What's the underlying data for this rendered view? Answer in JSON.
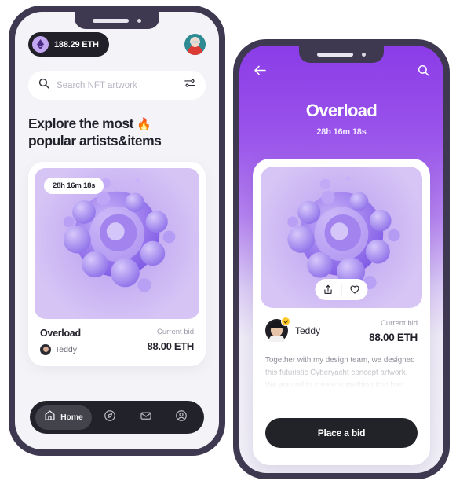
{
  "home_screen": {
    "wallet": {
      "amount": "188.29 ETH",
      "icon": "ethereum-icon"
    },
    "avatar": {
      "icon": "user-avatar"
    },
    "search": {
      "placeholder": "Search NFT artwork",
      "value": "",
      "search_icon": "search-icon",
      "filter_icon": "filter-icon"
    },
    "headline_line1": "Explore the most",
    "headline_emoji": "🔥",
    "headline_line2": "popular artists&items",
    "featured_card": {
      "timer": "28h 16m 18s",
      "title": "Overload",
      "creator": "Teddy",
      "bid_label": "Current bid",
      "bid_value": "88.00 ETH"
    },
    "nav": [
      {
        "label": "Home",
        "icon": "home-icon",
        "active": true
      },
      {
        "label": "",
        "icon": "compass-icon",
        "active": false
      },
      {
        "label": "",
        "icon": "mail-icon",
        "active": false
      },
      {
        "label": "",
        "icon": "profile-icon",
        "active": false
      }
    ]
  },
  "detail_screen": {
    "back_icon": "back-arrow-icon",
    "search_icon": "search-icon",
    "title": "Overload",
    "timer": "28h 16m 18s",
    "image_actions": {
      "share_icon": "share-icon",
      "like_icon": "heart-icon"
    },
    "creator": "Teddy",
    "verified_icon": "verified-badge-icon",
    "bid_label": "Current bid",
    "bid_value": "88.00 ETH",
    "description": "Together with my design team, we designed this futuristic Cyberyacht concept artwork. We wanted to create something that has",
    "cta_label": "Place a bid"
  },
  "colors": {
    "frame": "#3e3951",
    "accent_purple": "#8b3ce8",
    "dark": "#222229",
    "artwork_purple": "#9b7ded"
  }
}
